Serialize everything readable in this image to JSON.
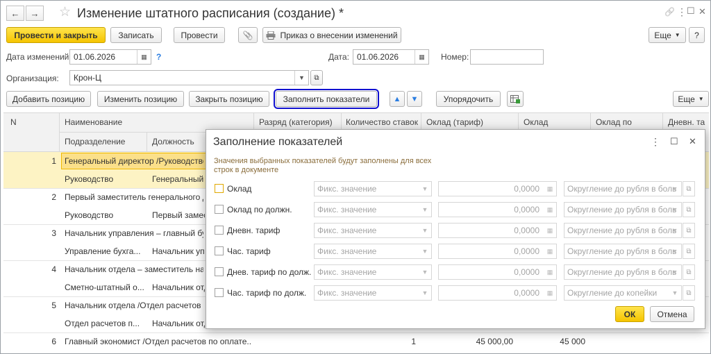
{
  "window": {
    "title": "Изменение штатного расписания (создание) *",
    "more_label": "Еще",
    "nav_back": "←",
    "nav_forward": "→",
    "star_icon": "☆",
    "link_icon": "🔗",
    "menu_icon": "⋮",
    "max_icon": "☐",
    "close_icon": "✕"
  },
  "toolbar": {
    "post_close": "Провести и закрыть",
    "save": "Записать",
    "post": "Провести",
    "attach_icon": "📎",
    "print_order": "Приказ о внесении изменений"
  },
  "form": {
    "change_date_label": "Дата изменений:",
    "change_date": "01.06.2026",
    "help": "?",
    "date_label": "Дата:",
    "date": "01.06.2026",
    "number_label": "Номер:",
    "number": "",
    "org_label": "Организация:",
    "org": "Крон-Ц"
  },
  "table_toolbar": {
    "add": "Добавить позицию",
    "change": "Изменить позицию",
    "close": "Закрыть позицию",
    "fill": "Заполнить показатели",
    "order": "Упорядочить",
    "more": "Еще"
  },
  "table": {
    "headers": {
      "n": "N",
      "name": "Наименование",
      "dept": "Подразделение",
      "position": "Должность",
      "rank": "Разряд (категория)",
      "rates": "Количество ставок",
      "salary_tariff": "Оклад (тариф)",
      "salary": "Оклад",
      "salary_by": "Оклад по",
      "daily": "Дневн. та"
    },
    "rows": [
      {
        "n": "1",
        "name": "Генеральный директор /Руководство/",
        "dept": "Руководство",
        "position": "Генеральный ди"
      },
      {
        "n": "2",
        "name": "Первый заместитель генерального ди",
        "dept": "Руководство",
        "position": "Первый замест"
      },
      {
        "n": "3",
        "name": "Начальник управления – главный бух",
        "dept": "Управление бухга...",
        "position": "Начальник упр"
      },
      {
        "n": "4",
        "name": "Начальник отдела – заместитель нача",
        "dept": "Сметно-штатный о...",
        "position": "Начальник отд"
      },
      {
        "n": "5",
        "name": "Начальник отдела /Отдел расчетов по",
        "dept": "Отдел расчетов п...",
        "position": "Начальник отд"
      },
      {
        "n": "6",
        "name": "Главный экономист /Отдел расчетов по оплате...",
        "rates": "1",
        "salary_tariff": "45 000,00",
        "salary": "45 000"
      }
    ]
  },
  "dialog": {
    "title": "Заполнение показателей",
    "hint": "Значения выбранных показателей будут заполнены для всех строк в документе",
    "ok": "ОК",
    "cancel": "Отмена",
    "rows": [
      {
        "label": "Оклад",
        "kind": "Фикс. значение",
        "value": "0,0000",
        "round": "Округление до рубля в боль"
      },
      {
        "label": "Оклад по должн.",
        "kind": "Фикс. значение",
        "value": "0,0000",
        "round": "Округление до рубля в боль"
      },
      {
        "label": "Дневн. тариф",
        "kind": "Фикс. значение",
        "value": "0,0000",
        "round": "Округление до рубля в боль"
      },
      {
        "label": "Час. тариф",
        "kind": "Фикс. значение",
        "value": "0,0000",
        "round": "Округление до рубля в боль"
      },
      {
        "label": "Днев. тариф по долж.",
        "kind": "Фикс. значение",
        "value": "0,0000",
        "round": "Округление до рубля в боль"
      },
      {
        "label": "Час. тариф по долж.",
        "kind": "Фикс. значение",
        "value": "0,0000",
        "round": "Округление до копейки"
      }
    ]
  }
}
